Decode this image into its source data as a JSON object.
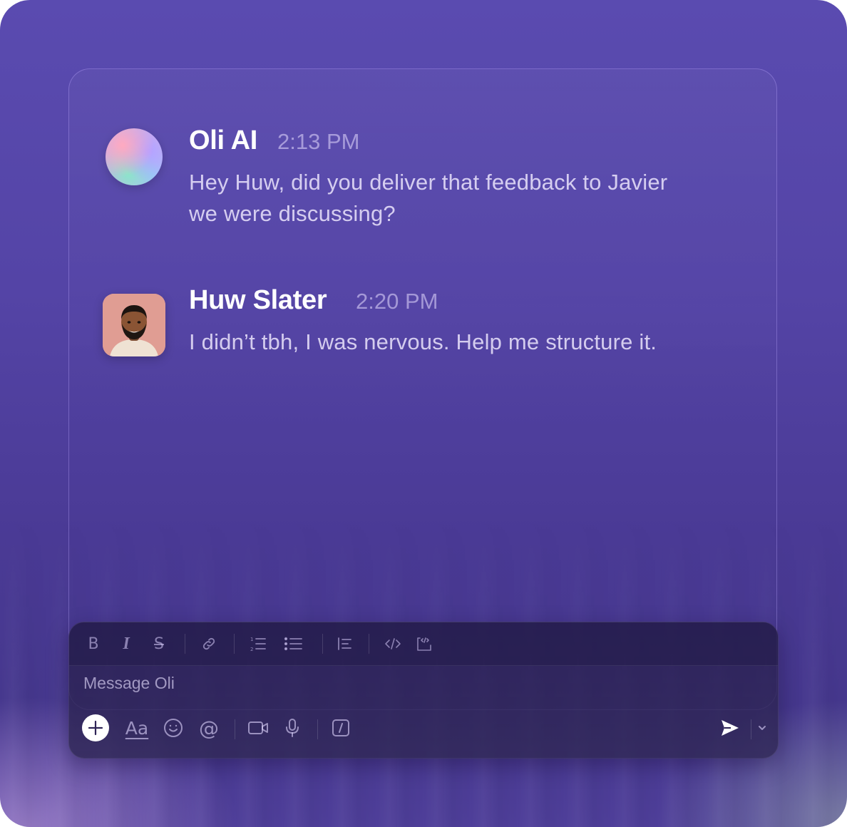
{
  "messages": [
    {
      "sender": "Oli AI",
      "time": "2:13 PM",
      "lines": [
        "Hey Huw, did you deliver that feedback to Javier",
        "we were discussing?"
      ],
      "avatar_icon": "ai-orb-avatar"
    },
    {
      "sender": "Huw Slater",
      "time": "2:20 PM",
      "lines": [
        "I didn’t tbh, I was nervous. Help me structure it."
      ],
      "avatar_icon": "user-photo-avatar"
    }
  ],
  "composer": {
    "placeholder": "Message Oli",
    "toolbar": [
      "bold-icon",
      "italic-icon",
      "strikethrough-icon",
      "link-icon",
      "ordered-list-icon",
      "bullet-list-icon",
      "blockquote-icon",
      "code-icon",
      "code-block-icon"
    ],
    "actions": [
      "add-icon",
      "text-format-icon",
      "emoji-icon",
      "mention-icon",
      "video-icon",
      "microphone-icon",
      "slash-command-icon",
      "send-icon",
      "chevron-down-icon"
    ],
    "bold_glyph": "B",
    "italic_glyph": "I",
    "strike_glyph": "S",
    "format_glyph": "Aa",
    "mention_glyph": "@"
  },
  "colors": {
    "background": "#5444a6",
    "text_primary": "#ffffff",
    "composer": "#2e2456"
  }
}
